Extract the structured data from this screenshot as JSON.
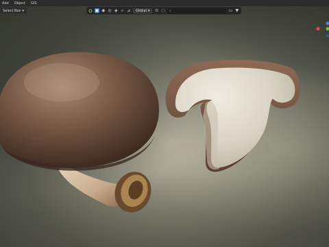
{
  "menubar": {
    "items": [
      "Add",
      "Object",
      "GIS"
    ]
  },
  "select_box": {
    "label": "Select Box"
  },
  "header": {
    "transform_orientation": "Global"
  },
  "colors": {
    "accent": "#4772b3",
    "gizmo_x": "#e04a4a",
    "gizmo_y": "#6fbf40",
    "gizmo_z": "#4a7fe0",
    "mushroom_cap": "#7a5b48",
    "mushroom_flesh": "#dcd7ca"
  },
  "icons": [
    "cursor-icon",
    "select-mode-icon",
    "vertex-icon",
    "edge-icon",
    "face-icon",
    "search-icon",
    "snap-icon",
    "proportional-icon",
    "overlay-icon",
    "filter-icon"
  ]
}
